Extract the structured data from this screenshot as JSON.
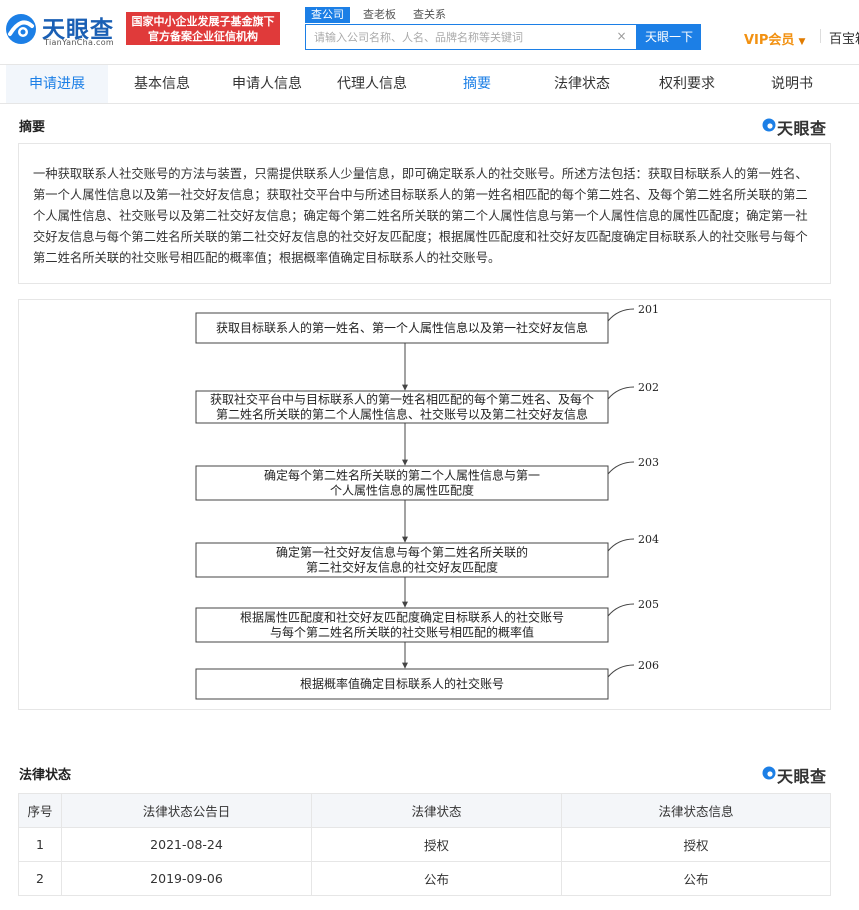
{
  "header": {
    "logo_name": "天眼查",
    "logo_url": "TianYanCha.com",
    "promo_line1": "国家中小企业发展子基金旗下",
    "promo_line2": "官方备案企业征信机构",
    "search_tabs": [
      "查公司",
      "查老板",
      "查关系"
    ],
    "search_placeholder": "请输入公司名称、人名、品牌名称等关键词",
    "search_button": "天眼一下",
    "vip_label": "VIP会员",
    "user_label": "百宝箱"
  },
  "tabs": [
    "申请进展",
    "基本信息",
    "申请人信息",
    "代理人信息",
    "摘要",
    "法律状态",
    "权利要求",
    "说明书"
  ],
  "abstract": {
    "title": "摘要",
    "brand": "天眼查",
    "text": "一种获取联系人社交账号的方法与装置，只需提供联系人少量信息，即可确定联系人的社交账号。所述方法包括：获取目标联系人的第一姓名、第一个人属性信息以及第一社交好友信息；获取社交平台中与所述目标联系人的第一姓名相匹配的每个第二姓名、及每个第二姓名所关联的第二个人属性信息、社交账号以及第二社交好友信息；确定每个第二姓名所关联的第二个人属性信息与第一个人属性信息的属性匹配度；确定第一社交好友信息与每个第二姓名所关联的第二社交好友信息的社交好友匹配度；根据属性匹配度和社交好友匹配度确定目标联系人的社交账号与每个第二姓名所关联的社交账号相匹配的概率值；根据概率值确定目标联系人的社交账号。"
  },
  "flowchart": {
    "steps": [
      {
        "num": "201",
        "lines": [
          "获取目标联系人的第一姓名、第一个人属性信息以及第一社交好友信息"
        ]
      },
      {
        "num": "202",
        "lines": [
          "获取社交平台中与目标联系人的第一姓名相匹配的每个第二姓名、及每个",
          "第二姓名所关联的第二个人属性信息、社交账号以及第二社交好友信息"
        ]
      },
      {
        "num": "203",
        "lines": [
          "确定每个第二姓名所关联的第二个人属性信息与第一",
          "个人属性信息的属性匹配度"
        ]
      },
      {
        "num": "204",
        "lines": [
          "确定第一社交好友信息与每个第二姓名所关联的",
          "第二社交好友信息的社交好友匹配度"
        ]
      },
      {
        "num": "205",
        "lines": [
          "根据属性匹配度和社交好友匹配度确定目标联系人的社交账号",
          "与每个第二姓名所关联的社交账号相匹配的概率值"
        ]
      },
      {
        "num": "206",
        "lines": [
          "根据概率值确定目标联系人的社交账号"
        ]
      }
    ]
  },
  "legal": {
    "title": "法律状态",
    "brand": "天眼查",
    "columns": [
      "序号",
      "法律状态公告日",
      "法律状态",
      "法律状态信息"
    ],
    "rows": [
      [
        "1",
        "2021-08-24",
        "授权",
        "授权"
      ],
      [
        "2",
        "2019-09-06",
        "公布",
        "公布"
      ]
    ]
  }
}
